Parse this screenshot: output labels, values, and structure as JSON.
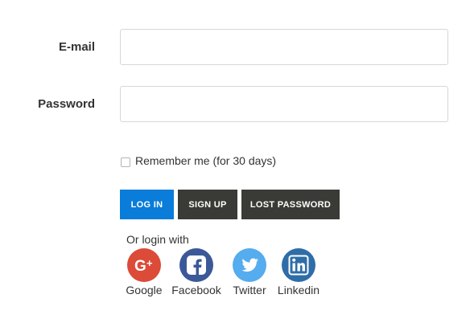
{
  "form": {
    "email_label": "E-mail",
    "email_value": "",
    "password_label": "Password",
    "password_value": "",
    "remember_label": "Remember me (for 30 days)",
    "remember_checked": false
  },
  "buttons": {
    "login": "LOG IN",
    "signup": "SIGN UP",
    "lost_password": "LOST PASSWORD"
  },
  "social": {
    "heading": "Or login with",
    "providers": [
      {
        "name": "Google",
        "icon": "google-plus-icon",
        "color": "#dc4a38"
      },
      {
        "name": "Facebook",
        "icon": "facebook-icon",
        "color": "#3b5998"
      },
      {
        "name": "Twitter",
        "icon": "twitter-icon",
        "color": "#55acee"
      },
      {
        "name": "Linkedin",
        "icon": "linkedin-icon",
        "color": "#0077b5"
      }
    ]
  },
  "colors": {
    "primary": "#0a7cd9",
    "dark_button": "#3a3a36",
    "text": "#333333",
    "border": "#d7d7d7"
  }
}
